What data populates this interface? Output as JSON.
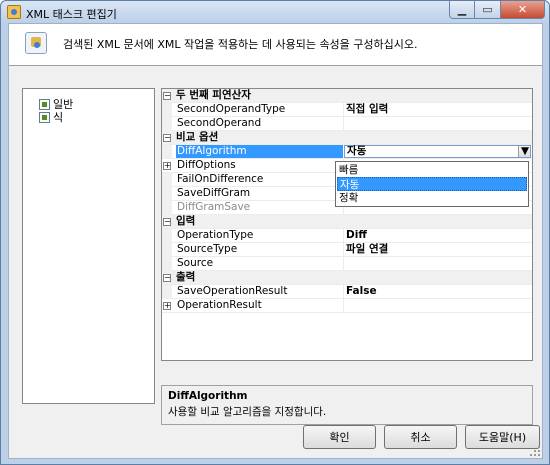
{
  "window": {
    "title": "XML 태스크 편집기"
  },
  "header": {
    "description": "검색된 XML 문서에 XML 작업을 적용하는 데 사용되는 속성을 구성하십시오."
  },
  "nav": {
    "items": [
      {
        "label": "일반"
      },
      {
        "label": "식"
      }
    ]
  },
  "grid": {
    "cat1": {
      "label": "두 번째 피연산자",
      "expander": "⊟"
    },
    "second_operand_type": {
      "name": "SecondOperandType",
      "value": "직접 입력"
    },
    "second_operand": {
      "name": "SecondOperand",
      "value": ""
    },
    "cat2": {
      "label": "비교 옵션",
      "expander": "⊟"
    },
    "diff_algorithm": {
      "name": "DiffAlgorithm",
      "value": "자동"
    },
    "diff_options": {
      "name": "DiffOptions",
      "expander": "⊞"
    },
    "fail_on_difference": {
      "name": "FailOnDifference"
    },
    "save_diffgram": {
      "name": "SaveDiffGram"
    },
    "diffgram_save": {
      "name": "DiffGramSave"
    },
    "cat3": {
      "label": "입력",
      "expander": "⊟"
    },
    "operation_type": {
      "name": "OperationType",
      "value": "Diff"
    },
    "source_type": {
      "name": "SourceType",
      "value": "파일 연결"
    },
    "source": {
      "name": "Source",
      "value": ""
    },
    "cat4": {
      "label": "출력",
      "expander": "⊟"
    },
    "save_operation_result": {
      "name": "SaveOperationResult",
      "value": "False"
    },
    "operation_result": {
      "name": "OperationResult",
      "expander": "⊞"
    }
  },
  "dropdown": {
    "options": [
      {
        "label": "빠름"
      },
      {
        "label": "자동"
      },
      {
        "label": "정확"
      }
    ],
    "selected": "자동"
  },
  "description": {
    "title": "DiffAlgorithm",
    "text": "사용할 비교 알고리즘을 지정합니다."
  },
  "buttons": {
    "ok": "확인",
    "cancel": "취소",
    "help": "도움말(H)"
  }
}
